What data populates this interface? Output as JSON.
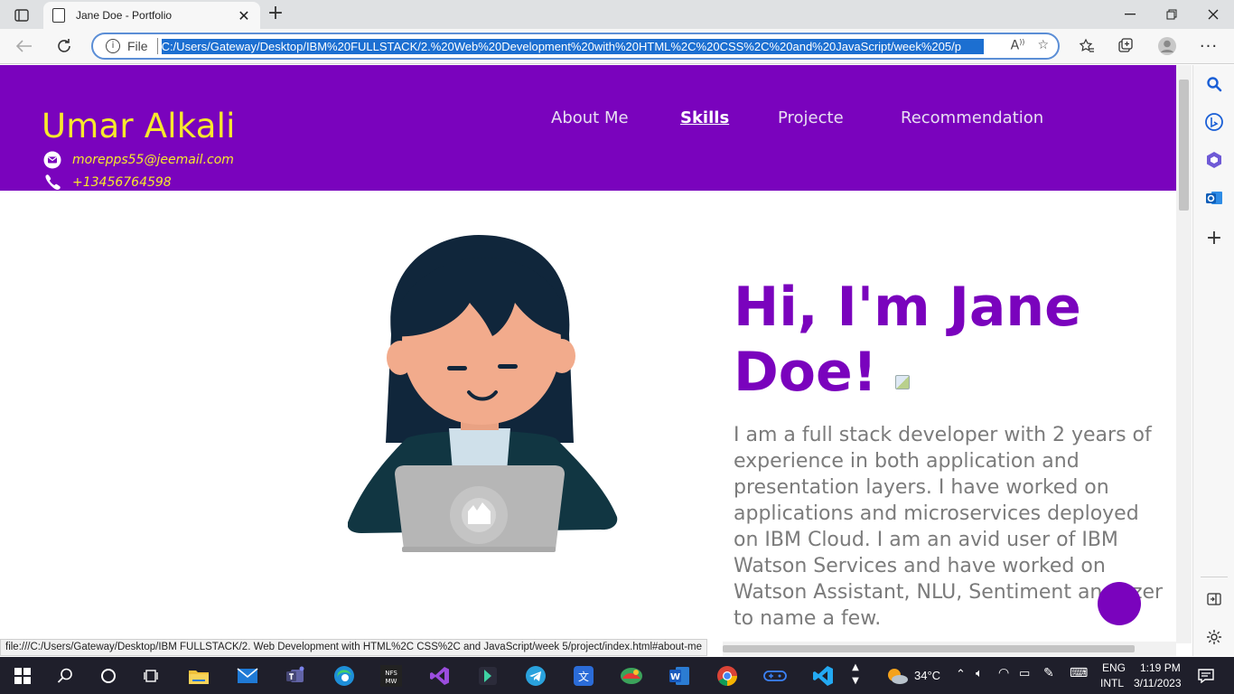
{
  "browser": {
    "tab": {
      "title": "Jane Doe - Portfolio"
    },
    "address": {
      "scheme_label": "File",
      "url": "C:/Users/Gateway/Desktop/IBM%20FULLSTACK/2.%20Web%20Development%20with%20HTML%2C%20CSS%2C%20and%20JavaScript/week%205/p"
    },
    "status_link": "file:///C:/Users/Gateway/Desktop/IBM FULLSTACK/2. Web Development with HTML%2C CSS%2C and JavaScript/week 5/project/index.html#about-me"
  },
  "page": {
    "header": {
      "name": "Umar Alkali",
      "email": "morepps55@jeemail.com",
      "phone": "+13456764598"
    },
    "nav": [
      {
        "label": "About Me"
      },
      {
        "label": "Skills"
      },
      {
        "label": "Projecte"
      },
      {
        "label": "Recommendation"
      }
    ],
    "hero": {
      "title_line1": "Hi, I'm Jane",
      "title_line2": "Doe!",
      "description": "I am a full stack developer with 2 years of experience in both application and presentation layers. I have worked on applications and microservices deployed on IBM Cloud. I am an avid user of IBM Watson Services and have worked on Watson Assistant, NLU, Sentiment analyzer to name a few."
    }
  },
  "taskbar": {
    "weather": "34°C",
    "language_line1": "ENG",
    "language_line2": "INTL",
    "time": "1:19 PM",
    "date": "3/11/2023"
  },
  "colors": {
    "brand_purple": "#7a03bd",
    "brand_yellow": "#f7e92c",
    "text_gray": "#7b7b7b"
  }
}
